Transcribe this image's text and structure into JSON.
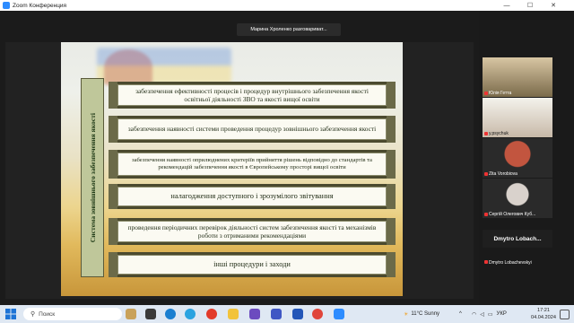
{
  "window": {
    "title": "Zoom Конференция",
    "minimize": "—",
    "maximize": "☐",
    "close": "✕"
  },
  "active_speaker": "Марина Хроленко разговариват...",
  "slide": {
    "vertical_title": "Система зовнішнього забезпечення якості",
    "items": [
      "забезпечення ефективності процесів і процедур внутрішнього забезпечення якості освітньої діяльності ЗВО та якості вищої освіти",
      "забезпечення наявності системи проведення процедур зовнішнього забезпечення якості",
      "забезпечення наявності оприлюднених критеріїв прийняття рішень відповідно до стандартів та рекомендацій забезпечення якості в Європейському просторі вищої освіти",
      "налагодження доступного і зрозумілого звітування",
      "проведення періодичних перевірок діяльності систем забезпечення якості та механізмів роботи з отриманими рекомендаціями",
      "інші процедури і заходи"
    ]
  },
  "participants": [
    {
      "name": "Юлія Гетта",
      "muted": true
    },
    {
      "name": "y.psychuk",
      "muted": true
    },
    {
      "name": "Zita Vorobiova",
      "muted": true
    },
    {
      "name": "Сергій Олегович Куб...",
      "muted": true
    },
    {
      "name": "Dmytro  Lobach...",
      "muted": false
    },
    {
      "name": "Dmytro Lobachevskyi",
      "muted": true
    }
  ],
  "taskbar": {
    "search_placeholder": "Поиск",
    "weather": "11°C  Sunny",
    "language": "УКР",
    "time": "17:21",
    "date": "04.04.2024",
    "hidden_icons": "^"
  },
  "colors": {
    "zoom_blue": "#2d8cff",
    "item_border": "#4b4a2f",
    "vertical_bar": "#bfc79a",
    "mute_red": "#e33333"
  }
}
